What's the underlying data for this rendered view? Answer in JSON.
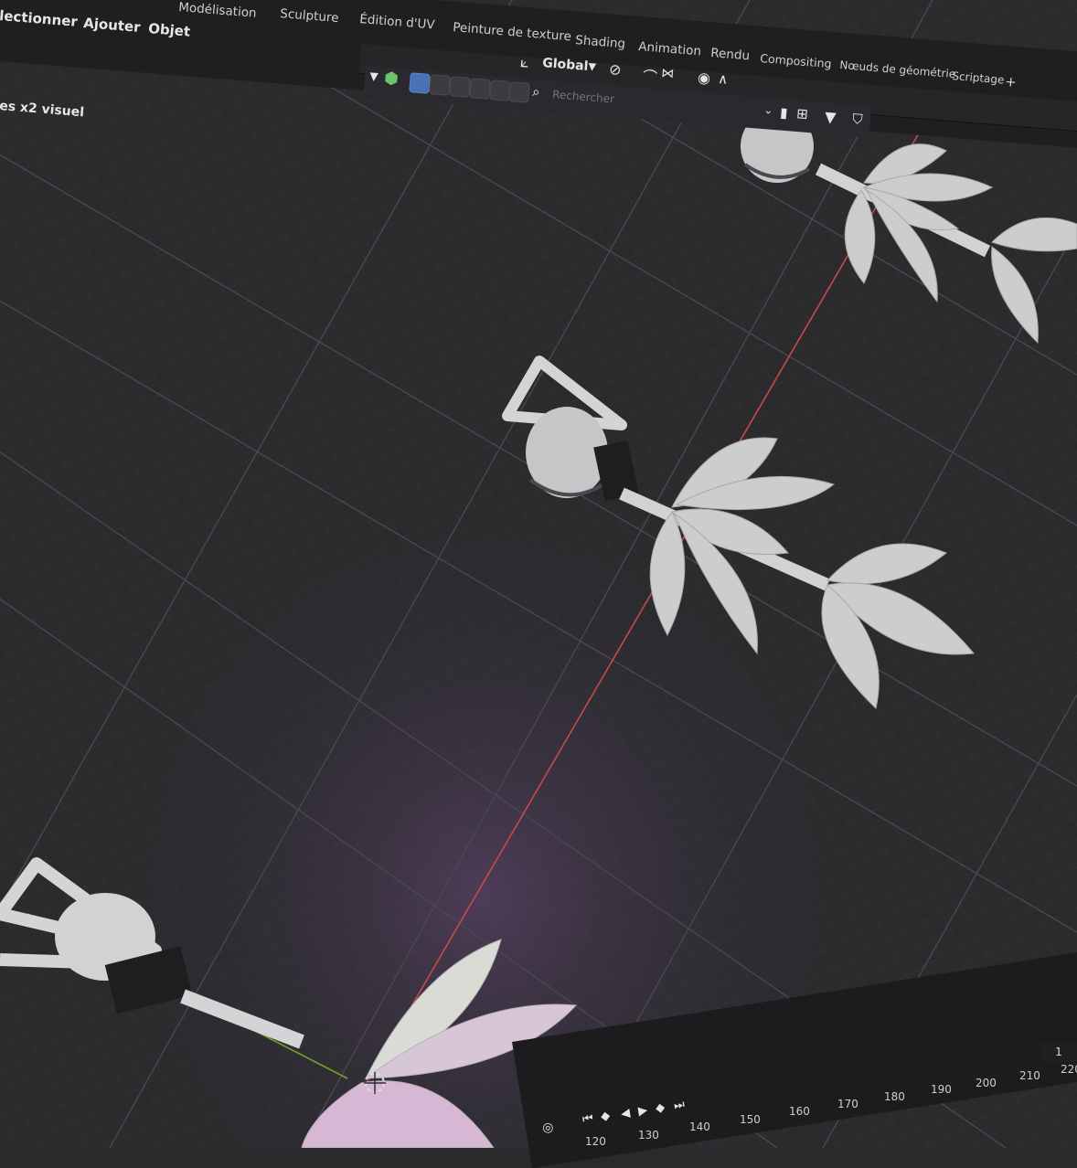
{
  "menu": {
    "select_label": "lectionner",
    "add_label": "Ajouter",
    "object_label": "Objet"
  },
  "workspace_tabs": [
    "Modélisation",
    "Sculpture",
    "Édition d'UV",
    "Peinture de texture",
    "Shading",
    "Animation",
    "Rendu",
    "Compositing",
    "Nœuds de géométrie",
    "Scriptage"
  ],
  "add_workspace_label": "+",
  "viewport_overlay_text": "es x2 visuel",
  "toolbar": {
    "transform_orientation": "Global",
    "search_placeholder": "Rechercher"
  },
  "timeline": {
    "current_frame": "1",
    "ticks": [
      "120",
      "130",
      "140",
      "150",
      "160",
      "170",
      "180",
      "190",
      "200",
      "210",
      "220"
    ]
  },
  "colors": {
    "viewport_bg": "#2a2a2d",
    "grid_line": "#3a3a3e",
    "x_axis": "#c8484c",
    "y_axis": "#6aa52a",
    "mesh": "#cdcdcf",
    "active_button": "#4772b3"
  },
  "icons": {
    "viewport_shading": "sphere-icon",
    "orientation": "axes-icon",
    "search": "search-icon",
    "play": "play-icon",
    "filter": "filter-icon"
  }
}
